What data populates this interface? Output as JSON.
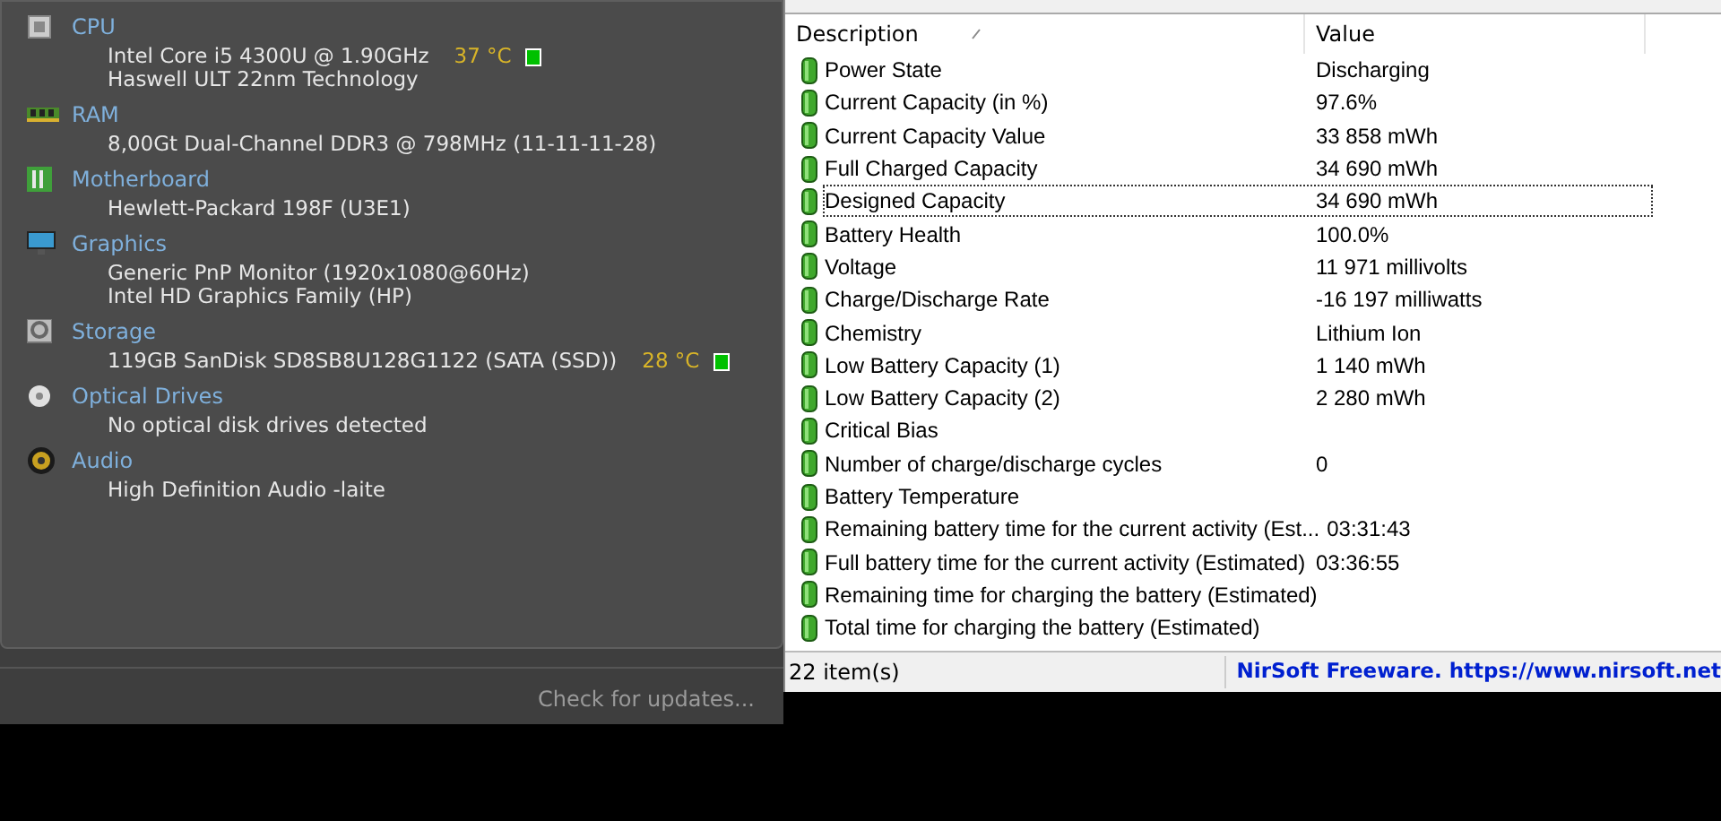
{
  "summary": {
    "sections": [
      {
        "kind": "cpu",
        "title": "CPU",
        "lines": [
          {
            "text": "Intel Core i5 4300U @ 1.90GHz",
            "temp": "37 °C",
            "color": "#00c000"
          },
          {
            "text": "Haswell ULT 22nm Technology"
          }
        ]
      },
      {
        "kind": "ram",
        "title": "RAM",
        "lines": [
          {
            "text": "8,00Gt Dual-Channel DDR3 @ 798MHz (11-11-11-28)"
          }
        ]
      },
      {
        "kind": "motherboard",
        "title": "Motherboard",
        "lines": [
          {
            "text": "Hewlett-Packard 198F (U3E1)"
          }
        ]
      },
      {
        "kind": "graphics",
        "title": "Graphics",
        "lines": [
          {
            "text": "Generic PnP Monitor (1920x1080@60Hz)"
          },
          {
            "text": "Intel HD Graphics Family (HP)"
          }
        ]
      },
      {
        "kind": "storage",
        "title": "Storage",
        "lines": [
          {
            "text": "119GB SanDisk SD8SB8U128G1122 (SATA (SSD))",
            "temp": "28 °C",
            "color": "#00c000"
          }
        ]
      },
      {
        "kind": "optical",
        "title": "Optical Drives",
        "lines": [
          {
            "text": "No optical disk drives detected"
          }
        ]
      },
      {
        "kind": "audio",
        "title": "Audio",
        "lines": [
          {
            "text": "High Definition Audio -laite"
          }
        ]
      }
    ],
    "update_link": "Check for updates..."
  },
  "battery_table": {
    "columns": [
      "Description",
      "Value"
    ],
    "rows": [
      {
        "description": "Power State",
        "value": "Discharging",
        "selected": false
      },
      {
        "description": "Current Capacity (in %)",
        "value": "97.6%",
        "selected": false
      },
      {
        "description": "Current Capacity Value",
        "value": "33 858 mWh",
        "selected": false
      },
      {
        "description": "Full Charged Capacity",
        "value": "34 690 mWh",
        "selected": false
      },
      {
        "description": "Designed Capacity",
        "value": "34 690 mWh",
        "selected": true
      },
      {
        "description": "Battery Health",
        "value": "100.0%",
        "selected": false
      },
      {
        "description": "Voltage",
        "value": "11 971 millivolts",
        "selected": false
      },
      {
        "description": "Charge/Discharge Rate",
        "value": "-16 197 milliwatts",
        "selected": false
      },
      {
        "description": "Chemistry",
        "value": "Lithium Ion",
        "selected": false
      },
      {
        "description": "Low Battery Capacity (1)",
        "value": "1 140 mWh",
        "selected": false
      },
      {
        "description": "Low Battery Capacity (2)",
        "value": "2 280 mWh",
        "selected": false
      },
      {
        "description": "Critical Bias",
        "selected": false
      },
      {
        "description": "Number of charge/discharge cycles",
        "value": "0",
        "selected": false
      },
      {
        "description": "Battery Temperature",
        "selected": false
      },
      {
        "description": "Remaining battery time for the current activity (Est...",
        "value": "03:31:43",
        "selected": false
      },
      {
        "description": "Full battery time for the current activity (Estimated)",
        "value": "03:36:55",
        "selected": false
      },
      {
        "description": "Remaining time for charging the battery (Estimated)",
        "selected": false
      },
      {
        "description": "Total  time for charging the battery (Estimated)",
        "selected": false
      }
    ]
  },
  "status_bar": {
    "count": "22 item(s)",
    "credit": "NirSoft Freeware. https://www.nirsoft.net"
  }
}
